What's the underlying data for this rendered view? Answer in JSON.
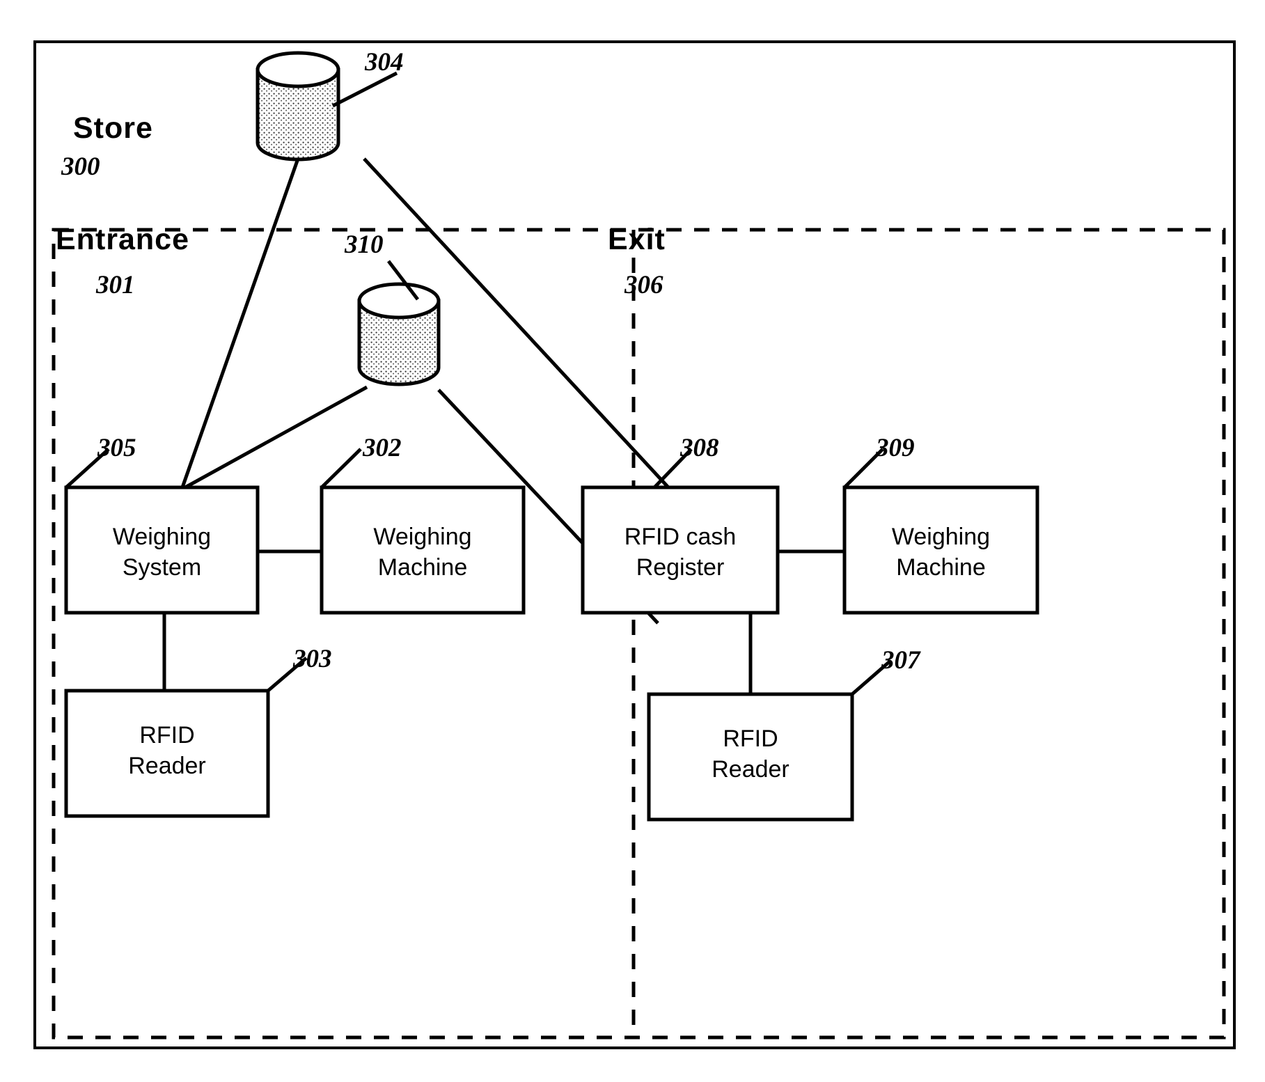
{
  "figure": {
    "type": "patent-block-diagram",
    "background_color": "#ffffff",
    "line_color": "#000000"
  },
  "regions": {
    "store": {
      "title": "Store",
      "ref": "300"
    },
    "entrance": {
      "title": "Entrance",
      "ref": "301"
    },
    "exit": {
      "title": "Exit",
      "ref": "306"
    }
  },
  "databases": [
    {
      "id": "db-304",
      "ref": "304",
      "shape": "cylinder"
    },
    {
      "id": "db-310",
      "ref": "310",
      "shape": "cylinder"
    }
  ],
  "boxes": [
    {
      "id": "weighing-system",
      "label": "Weighing\nSystem",
      "ref": "305",
      "region": "entrance"
    },
    {
      "id": "weighing-machine-entrance",
      "label": "Weighing\nMachine",
      "ref": "302",
      "region": "entrance"
    },
    {
      "id": "rfid-reader-entrance",
      "label": "RFID\nReader",
      "ref": "303",
      "region": "entrance"
    },
    {
      "id": "rfid-cash-register",
      "label": "RFID cash\nRegister",
      "ref": "308",
      "region": "exit"
    },
    {
      "id": "weighing-machine-exit",
      "label": "Weighing\nMachine",
      "ref": "309",
      "region": "exit"
    },
    {
      "id": "rfid-reader-exit",
      "label": "RFID\nReader",
      "ref": "307",
      "region": "exit"
    }
  ],
  "connections": [
    {
      "from": "db-304",
      "to": "weighing-system"
    },
    {
      "from": "db-304",
      "to": "rfid-cash-register"
    },
    {
      "from": "db-310",
      "to": "weighing-system"
    },
    {
      "from": "db-310",
      "to": "rfid-cash-register"
    },
    {
      "from": "weighing-system",
      "to": "weighing-machine-entrance"
    },
    {
      "from": "weighing-system",
      "to": "rfid-reader-entrance"
    },
    {
      "from": "rfid-cash-register",
      "to": "weighing-machine-exit"
    },
    {
      "from": "rfid-cash-register",
      "to": "rfid-reader-exit"
    }
  ]
}
